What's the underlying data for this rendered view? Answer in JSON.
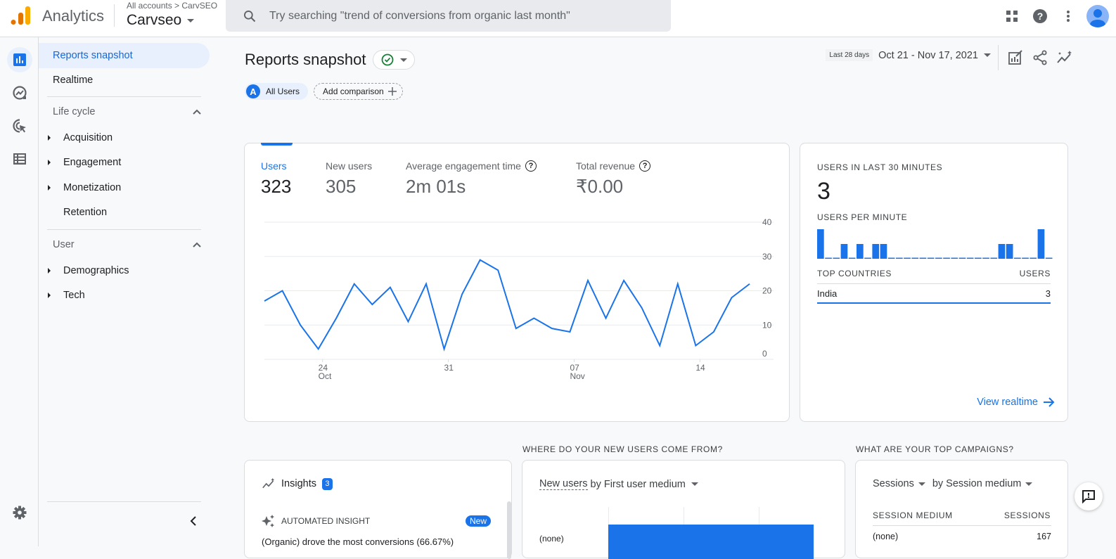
{
  "header": {
    "app_name": "Analytics",
    "breadcrumb": "All accounts > CarvSEO",
    "account_name": "Carvseo",
    "search_placeholder": "Try searching \"trend of conversions from organic last month\"",
    "icons": [
      "apps-icon",
      "help-icon",
      "more-vert-icon",
      "account-avatar"
    ]
  },
  "rail": {
    "items": [
      "reports-icon",
      "explore-icon",
      "advertising-icon",
      "configure-icon"
    ],
    "bottom": "settings-icon"
  },
  "nav": {
    "items": [
      {
        "label": "Reports snapshot",
        "active": true
      },
      {
        "label": "Realtime",
        "active": false
      }
    ],
    "groups": [
      {
        "label": "Life cycle",
        "expanded": true,
        "children": [
          {
            "label": "Acquisition",
            "expandable": true
          },
          {
            "label": "Engagement",
            "expandable": true
          },
          {
            "label": "Monetization",
            "expandable": true
          },
          {
            "label": "Retention",
            "expandable": false
          }
        ]
      },
      {
        "label": "User",
        "expanded": true,
        "children": [
          {
            "label": "Demographics",
            "expandable": true
          },
          {
            "label": "Tech",
            "expandable": true
          }
        ]
      }
    ]
  },
  "page": {
    "title": "Reports snapshot",
    "comparison_chip": {
      "letter": "A",
      "label": "All Users"
    },
    "add_comparison": "Add comparison",
    "date_tag": "Last 28 days",
    "date_range": "Oct 21 - Nov 17, 2021"
  },
  "metrics": [
    {
      "label": "Users",
      "value": "323",
      "active": true,
      "help": false
    },
    {
      "label": "New users",
      "value": "305",
      "active": false,
      "help": false
    },
    {
      "label": "Average engagement time",
      "value": "2m 01s",
      "active": false,
      "help": true
    },
    {
      "label": "Total revenue",
      "value": "₹0.00",
      "active": false,
      "help": true
    }
  ],
  "chart_data": [
    {
      "type": "line",
      "title": "Users",
      "x": [
        "Oct 21",
        "Oct 22",
        "Oct 23",
        "Oct 24",
        "Oct 25",
        "Oct 26",
        "Oct 27",
        "Oct 28",
        "Oct 29",
        "Oct 30",
        "Oct 31",
        "Nov 1",
        "Nov 2",
        "Nov 3",
        "Nov 4",
        "Nov 5",
        "Nov 6",
        "Nov 7",
        "Nov 8",
        "Nov 9",
        "Nov 10",
        "Nov 11",
        "Nov 12",
        "Nov 13",
        "Nov 14",
        "Nov 15",
        "Nov 16",
        "Nov 17"
      ],
      "series": [
        {
          "name": "Users",
          "values": [
            17,
            20,
            10,
            3,
            12,
            22,
            16,
            21,
            11,
            22,
            3,
            19,
            29,
            26,
            9,
            12,
            9,
            8,
            23,
            12,
            23,
            15,
            4,
            22,
            4,
            8,
            18,
            22
          ],
          "color": "#1a73e8"
        }
      ],
      "xticks": [
        {
          "index": 3,
          "label": "24",
          "sub": "Oct"
        },
        {
          "index": 10,
          "label": "31",
          "sub": ""
        },
        {
          "index": 17,
          "label": "07",
          "sub": "Nov"
        },
        {
          "index": 24,
          "label": "14",
          "sub": ""
        }
      ],
      "yticks": [
        "0",
        "10",
        "20",
        "30",
        "40"
      ],
      "ylim": [
        0,
        40
      ],
      "grid": true,
      "yaxis_side": "right"
    },
    {
      "type": "bar",
      "title": "USERS PER MINUTE",
      "values": [
        2,
        0,
        0,
        1,
        0,
        1,
        0,
        1,
        1,
        0,
        0,
        0,
        0,
        0,
        0,
        0,
        0,
        0,
        0,
        0,
        0,
        0,
        0,
        1,
        1,
        0,
        0,
        0,
        2,
        0
      ],
      "ylim": [
        0,
        2
      ],
      "color": "#1a73e8"
    }
  ],
  "realtime": {
    "title": "USERS IN LAST 30 MINUTES",
    "value": "3",
    "per_minute_label": "USERS PER MINUTE",
    "countries_header": "TOP COUNTRIES",
    "users_header": "USERS",
    "countries": [
      {
        "name": "India",
        "users": "3"
      }
    ],
    "view_link": "View realtime"
  },
  "insights": {
    "title": "Insights",
    "count": "3",
    "item_label": "AUTOMATED INSIGHT",
    "new_badge": "New",
    "text": "(Organic) drove the most conversions (66.67%)"
  },
  "new_users": {
    "section_title": "WHERE DO YOUR NEW USERS COME FROM?",
    "metric": "New users",
    "dimension": "by First user medium",
    "rows": [
      {
        "label": "(none)"
      }
    ]
  },
  "campaigns": {
    "section_title": "WHAT ARE YOUR TOP CAMPAIGNS?",
    "metric": "Sessions",
    "dimension": "by Session medium",
    "col1": "SESSION MEDIUM",
    "col2": "SESSIONS",
    "rows": [
      {
        "medium": "(none)",
        "sessions": "167"
      }
    ]
  }
}
